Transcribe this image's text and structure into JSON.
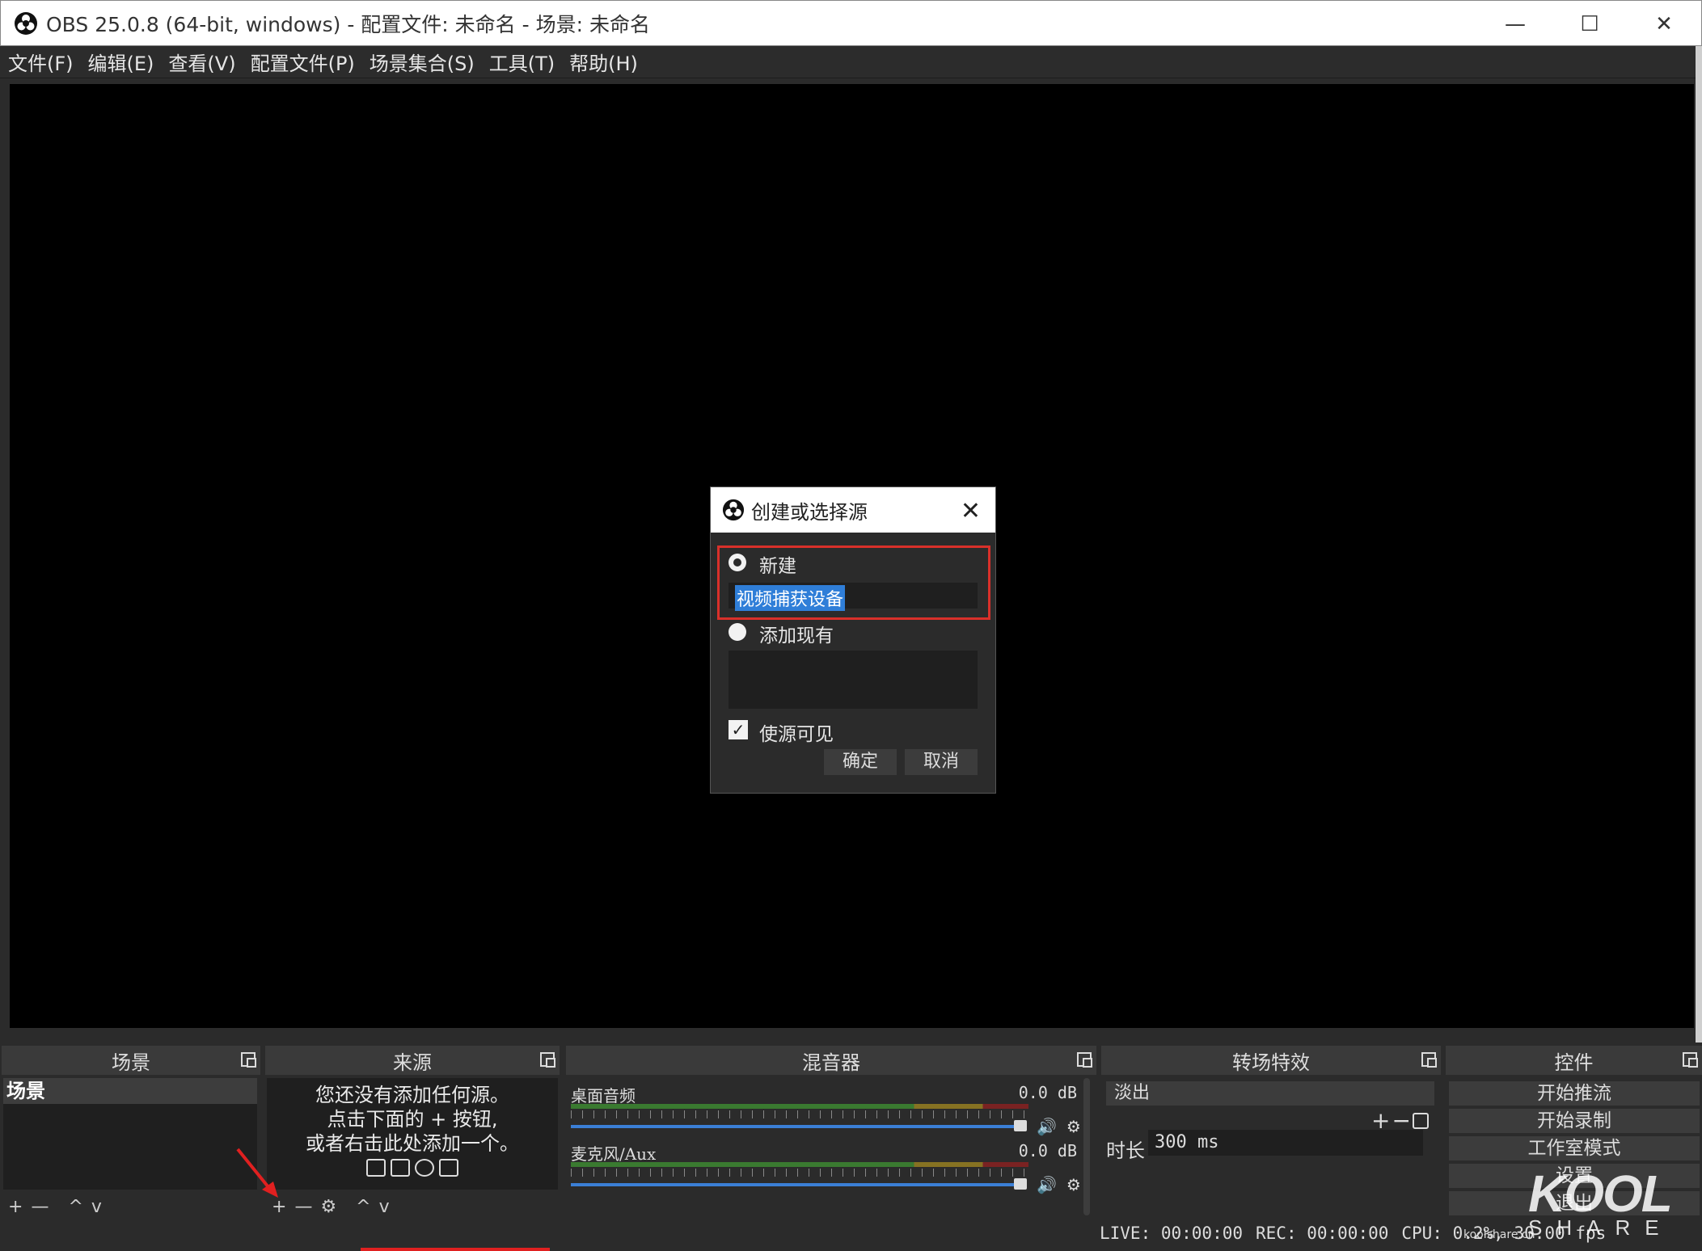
{
  "window": {
    "title": "OBS 25.0.8 (64-bit, windows) - 配置文件: 未命名 - 场景: 未命名",
    "minimize": "—",
    "maximize": "☐",
    "close": "✕"
  },
  "menu": [
    "文件(F)",
    "编辑(E)",
    "查看(V)",
    "配置文件(P)",
    "场景集合(S)",
    "工具(T)",
    "帮助(H)"
  ],
  "docks": {
    "scenes": {
      "title": "场景",
      "items": [
        "场景"
      ],
      "toolbar": [
        "+",
        "—",
        "^",
        "v"
      ]
    },
    "sources": {
      "title": "来源",
      "empty_line1": "您还没有添加任何源。",
      "empty_line2": "点击下面的 + 按钮,",
      "empty_line3": "或者右击此处添加一个。",
      "toolbar": [
        "+",
        "—",
        "⚙",
        "^",
        "v"
      ]
    },
    "mixer": {
      "title": "混音器",
      "channels": [
        {
          "name": "桌面音频",
          "db": "0.0 dB"
        },
        {
          "name": "麦克风/Aux",
          "db": "0.0 dB"
        }
      ]
    },
    "transitions": {
      "title": "转场特效",
      "selected": "淡出",
      "duration_label": "时长",
      "duration_value": "300 ms"
    },
    "controls": {
      "title": "控件",
      "buttons": [
        "开始推流",
        "开始录制",
        "工作室模式",
        "设置",
        "退出"
      ]
    }
  },
  "status": {
    "live": "LIVE: 00:00:00",
    "rec": "REC: 00:00:00",
    "cpu": "CPU: 0.2%, 30.00 fps"
  },
  "dialog": {
    "title": "创建或选择源",
    "new_label": "新建",
    "new_value": "视频捕获设备",
    "existing_label": "添加现有",
    "visible_label": "使源可见",
    "visible_checked": true,
    "ok": "确定",
    "cancel": "取消"
  },
  "watermark": {
    "big": "KOOL",
    "small": "SHARE",
    "url": "koolshare.cn"
  },
  "colors": {
    "highlight": "#d9302a",
    "selection": "#2f7ed8",
    "volume": "#3b7fd6"
  }
}
